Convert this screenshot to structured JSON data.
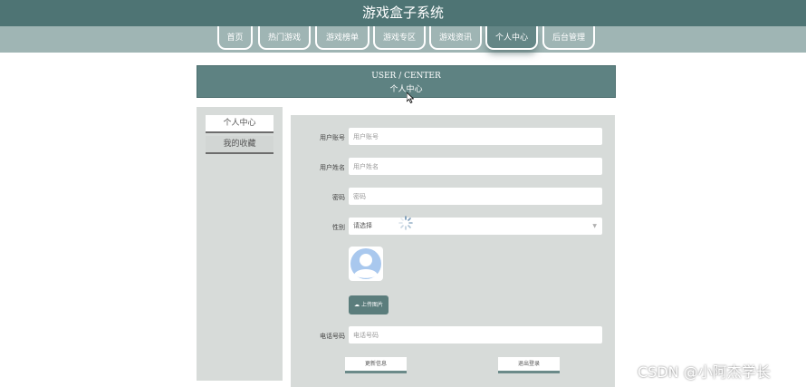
{
  "header": {
    "title": "游戏盒子系统"
  },
  "nav": {
    "items": [
      {
        "label": "首页"
      },
      {
        "label": "热门游戏"
      },
      {
        "label": "游戏榜单"
      },
      {
        "label": "游戏专区"
      },
      {
        "label": "游戏资讯"
      },
      {
        "label": "个人中心",
        "active": true
      },
      {
        "label": "后台管理"
      }
    ]
  },
  "banner": {
    "en": "USER / CENTER",
    "cn": "个人中心"
  },
  "sidebar": {
    "items": [
      {
        "label": "个人中心"
      },
      {
        "label": "我的收藏"
      }
    ]
  },
  "form": {
    "account": {
      "label": "用户账号",
      "placeholder": "用户账号"
    },
    "name": {
      "label": "用户姓名",
      "placeholder": "用户姓名"
    },
    "password": {
      "label": "密码",
      "placeholder": "密码"
    },
    "gender": {
      "label": "性别",
      "value": "请选择"
    },
    "upload_label": "上传图片",
    "phone": {
      "label": "电话号码",
      "placeholder": "电话号码"
    },
    "update_label": "更新信息",
    "logout_label": "退出登录"
  },
  "watermark": "CSDN @小阿杰学长",
  "colors": {
    "topbar": "#4e7474",
    "navbar": "#9fb5b4",
    "accent": "#5e8282",
    "panel": "#d7dbd9"
  },
  "icons": {
    "avatar": "user-silhouette-icon",
    "upload": "cloud-upload-icon",
    "select": "caret-down-icon",
    "loading": "loading-spinner-icon"
  }
}
